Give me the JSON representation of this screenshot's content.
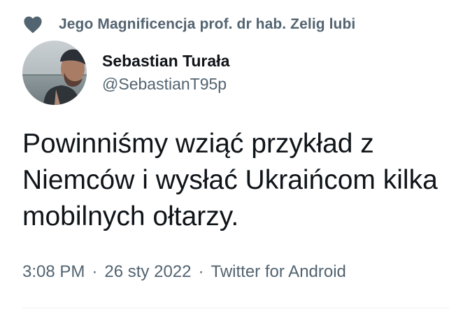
{
  "social_context": {
    "icon": "heart-icon",
    "text": "Jego Magnificencja prof. dr hab. Zelig lubi"
  },
  "author": {
    "display_name": "Sebastian Turała",
    "handle": "@SebastianT95p"
  },
  "tweet": {
    "text": "Powinniśmy wziąć przykład z Niemców i wysłać Ukraińcom kilka mobilnych ołtarzy."
  },
  "meta": {
    "time": "3:08 PM",
    "separator": "·",
    "date": "26 sty 2022",
    "source": "Twitter for Android"
  },
  "colors": {
    "primary_text": "#0f1419",
    "secondary_text": "#536471",
    "heart": "#536471",
    "divider": "#eff3f4"
  }
}
